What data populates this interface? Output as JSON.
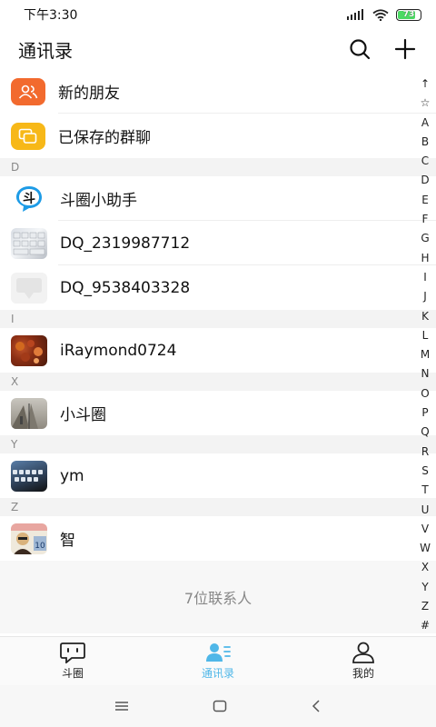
{
  "status": {
    "time": "下午3:30",
    "battery": "73",
    "battery_level": 0.73
  },
  "header": {
    "title": "通讯录",
    "search_icon": "search-icon",
    "add_icon": "plus-icon"
  },
  "fixed_items": [
    {
      "label": "新的朋友",
      "icon": "new-friends-icon",
      "color": "#f26a2e"
    },
    {
      "label": "已保存的群聊",
      "icon": "saved-groups-icon",
      "color": "#f7b818"
    }
  ],
  "sections": [
    {
      "letter": "D",
      "contacts": [
        "斗圈小助手",
        "DQ_2319987712",
        "DQ_9538403328"
      ]
    },
    {
      "letter": "I",
      "contacts": [
        "iRaymond0724"
      ]
    },
    {
      "letter": "X",
      "contacts": [
        "小斗圈"
      ]
    },
    {
      "letter": "Y",
      "contacts": [
        "ym"
      ]
    },
    {
      "letter": "Z",
      "contacts": [
        "智"
      ]
    }
  ],
  "contact_count": "7位联系人",
  "index_letters": [
    "↑",
    "☆",
    "A",
    "B",
    "C",
    "D",
    "E",
    "F",
    "G",
    "H",
    "I",
    "J",
    "K",
    "L",
    "M",
    "N",
    "O",
    "P",
    "Q",
    "R",
    "S",
    "T",
    "U",
    "V",
    "W",
    "X",
    "Y",
    "Z",
    "#"
  ],
  "tabs": [
    {
      "label": "斗圈",
      "icon": "chat-icon",
      "active": false
    },
    {
      "label": "通讯录",
      "icon": "contacts-icon",
      "active": true
    },
    {
      "label": "我的",
      "icon": "profile-icon",
      "active": false
    }
  ],
  "accent_color": "#4fb7e8"
}
